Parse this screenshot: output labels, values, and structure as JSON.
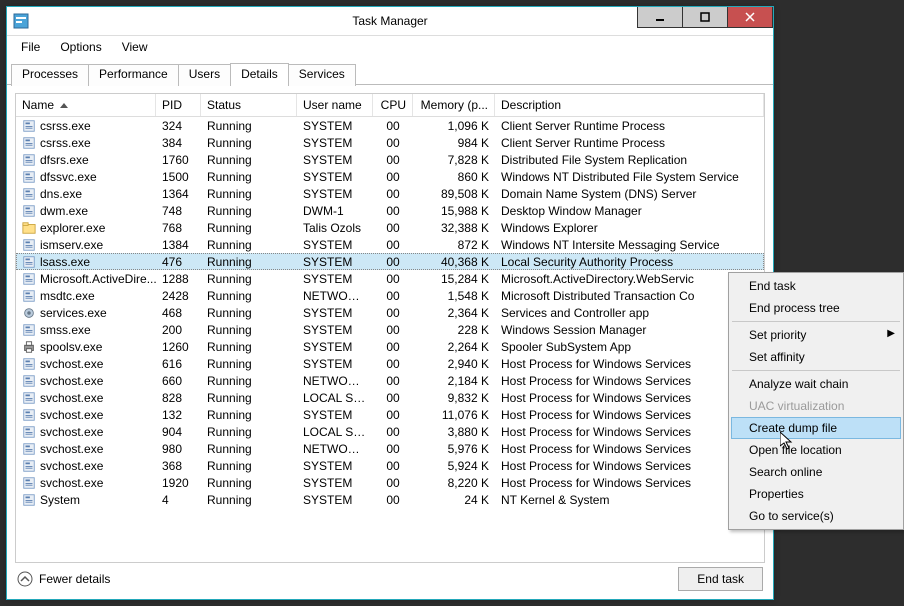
{
  "window": {
    "title": "Task Manager"
  },
  "menubar": [
    "File",
    "Options",
    "View"
  ],
  "tabs": [
    "Processes",
    "Performance",
    "Users",
    "Details",
    "Services"
  ],
  "active_tab": 3,
  "columns": [
    "Name",
    "PID",
    "Status",
    "User name",
    "CPU",
    "Memory (p...",
    "Description"
  ],
  "sort_col": 0,
  "selected_row": 8,
  "rows": [
    {
      "name": "csrss.exe",
      "pid": "324",
      "status": "Running",
      "user": "SYSTEM",
      "cpu": "00",
      "mem": "1,096 K",
      "desc": "Client Server Runtime Process",
      "icon": "app"
    },
    {
      "name": "csrss.exe",
      "pid": "384",
      "status": "Running",
      "user": "SYSTEM",
      "cpu": "00",
      "mem": "984 K",
      "desc": "Client Server Runtime Process",
      "icon": "app"
    },
    {
      "name": "dfsrs.exe",
      "pid": "1760",
      "status": "Running",
      "user": "SYSTEM",
      "cpu": "00",
      "mem": "7,828 K",
      "desc": "Distributed File System Replication",
      "icon": "app"
    },
    {
      "name": "dfssvc.exe",
      "pid": "1500",
      "status": "Running",
      "user": "SYSTEM",
      "cpu": "00",
      "mem": "860 K",
      "desc": "Windows NT Distributed File System Service",
      "icon": "app"
    },
    {
      "name": "dns.exe",
      "pid": "1364",
      "status": "Running",
      "user": "SYSTEM",
      "cpu": "00",
      "mem": "89,508 K",
      "desc": "Domain Name System (DNS) Server",
      "icon": "app"
    },
    {
      "name": "dwm.exe",
      "pid": "748",
      "status": "Running",
      "user": "DWM-1",
      "cpu": "00",
      "mem": "15,988 K",
      "desc": "Desktop Window Manager",
      "icon": "app"
    },
    {
      "name": "explorer.exe",
      "pid": "768",
      "status": "Running",
      "user": "Talis Ozols",
      "cpu": "00",
      "mem": "32,388 K",
      "desc": "Windows Explorer",
      "icon": "folder"
    },
    {
      "name": "ismserv.exe",
      "pid": "1384",
      "status": "Running",
      "user": "SYSTEM",
      "cpu": "00",
      "mem": "872 K",
      "desc": "Windows NT Intersite Messaging Service",
      "icon": "app"
    },
    {
      "name": "lsass.exe",
      "pid": "476",
      "status": "Running",
      "user": "SYSTEM",
      "cpu": "00",
      "mem": "40,368 K",
      "desc": "Local Security Authority Process",
      "icon": "app"
    },
    {
      "name": "Microsoft.ActiveDire...",
      "pid": "1288",
      "status": "Running",
      "user": "SYSTEM",
      "cpu": "00",
      "mem": "15,284 K",
      "desc": "Microsoft.ActiveDirectory.WebServic",
      "icon": "app"
    },
    {
      "name": "msdtc.exe",
      "pid": "2428",
      "status": "Running",
      "user": "NETWORK...",
      "cpu": "00",
      "mem": "1,548 K",
      "desc": "Microsoft Distributed Transaction Co",
      "icon": "app"
    },
    {
      "name": "services.exe",
      "pid": "468",
      "status": "Running",
      "user": "SYSTEM",
      "cpu": "00",
      "mem": "2,364 K",
      "desc": "Services and Controller app",
      "icon": "gear"
    },
    {
      "name": "smss.exe",
      "pid": "200",
      "status": "Running",
      "user": "SYSTEM",
      "cpu": "00",
      "mem": "228 K",
      "desc": "Windows Session Manager",
      "icon": "app"
    },
    {
      "name": "spoolsv.exe",
      "pid": "1260",
      "status": "Running",
      "user": "SYSTEM",
      "cpu": "00",
      "mem": "2,264 K",
      "desc": "Spooler SubSystem App",
      "icon": "printer"
    },
    {
      "name": "svchost.exe",
      "pid": "616",
      "status": "Running",
      "user": "SYSTEM",
      "cpu": "00",
      "mem": "2,940 K",
      "desc": "Host Process for Windows Services",
      "icon": "app"
    },
    {
      "name": "svchost.exe",
      "pid": "660",
      "status": "Running",
      "user": "NETWORK...",
      "cpu": "00",
      "mem": "2,184 K",
      "desc": "Host Process for Windows Services",
      "icon": "app"
    },
    {
      "name": "svchost.exe",
      "pid": "828",
      "status": "Running",
      "user": "LOCAL SE...",
      "cpu": "00",
      "mem": "9,832 K",
      "desc": "Host Process for Windows Services",
      "icon": "app"
    },
    {
      "name": "svchost.exe",
      "pid": "132",
      "status": "Running",
      "user": "SYSTEM",
      "cpu": "00",
      "mem": "11,076 K",
      "desc": "Host Process for Windows Services",
      "icon": "app"
    },
    {
      "name": "svchost.exe",
      "pid": "904",
      "status": "Running",
      "user": "LOCAL SE...",
      "cpu": "00",
      "mem": "3,880 K",
      "desc": "Host Process for Windows Services",
      "icon": "app"
    },
    {
      "name": "svchost.exe",
      "pid": "980",
      "status": "Running",
      "user": "NETWORK...",
      "cpu": "00",
      "mem": "5,976 K",
      "desc": "Host Process for Windows Services",
      "icon": "app"
    },
    {
      "name": "svchost.exe",
      "pid": "368",
      "status": "Running",
      "user": "SYSTEM",
      "cpu": "00",
      "mem": "5,924 K",
      "desc": "Host Process for Windows Services",
      "icon": "app"
    },
    {
      "name": "svchost.exe",
      "pid": "1920",
      "status": "Running",
      "user": "SYSTEM",
      "cpu": "00",
      "mem": "8,220 K",
      "desc": "Host Process for Windows Services",
      "icon": "app"
    },
    {
      "name": "System",
      "pid": "4",
      "status": "Running",
      "user": "SYSTEM",
      "cpu": "00",
      "mem": "24 K",
      "desc": "NT Kernel & System",
      "icon": "app"
    }
  ],
  "footer": {
    "fewer": "Fewer details",
    "end": "End task"
  },
  "context_menu": {
    "items": [
      {
        "label": "End task",
        "type": "item"
      },
      {
        "label": "End process tree",
        "type": "item"
      },
      {
        "type": "sep"
      },
      {
        "label": "Set priority",
        "type": "submenu"
      },
      {
        "label": "Set affinity",
        "type": "item"
      },
      {
        "type": "sep"
      },
      {
        "label": "Analyze wait chain",
        "type": "item"
      },
      {
        "label": "UAC virtualization",
        "type": "item",
        "disabled": true
      },
      {
        "label": "Create dump file",
        "type": "item",
        "highlight": true
      },
      {
        "label": "Open file location",
        "type": "item"
      },
      {
        "label": "Search online",
        "type": "item"
      },
      {
        "label": "Properties",
        "type": "item"
      },
      {
        "label": "Go to service(s)",
        "type": "item"
      }
    ]
  }
}
